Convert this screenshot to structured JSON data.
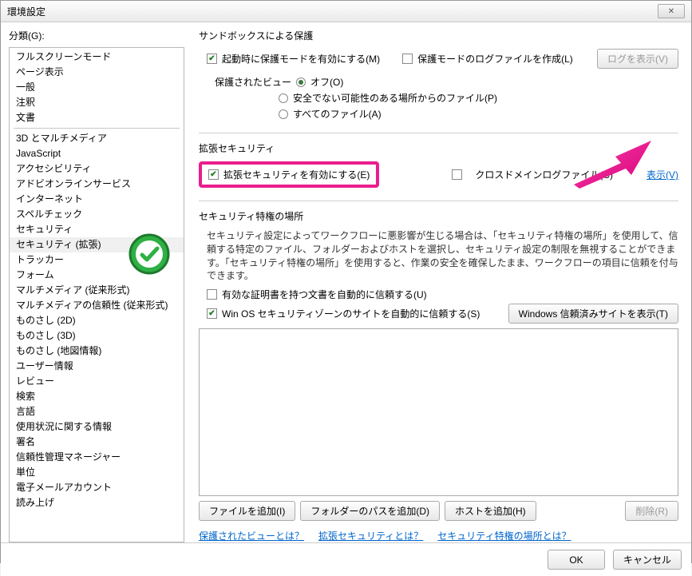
{
  "window": {
    "title": "環境設定",
    "close": "✕"
  },
  "sidebar": {
    "label": "分類(G):",
    "group1": [
      "フルスクリーンモード",
      "ページ表示",
      "一般",
      "注釈",
      "文書"
    ],
    "group2": [
      "3D とマルチメディア",
      "JavaScript",
      "アクセシビリティ",
      "アドビオンラインサービス",
      "インターネット",
      "スペルチェック",
      "セキュリティ",
      "セキュリティ (拡張)",
      "トラッカー",
      "フォーム",
      "マルチメディア (従来形式)",
      "マルチメディアの信頼性 (従来形式)",
      "ものさし (2D)",
      "ものさし (3D)",
      "ものさし (地図情報)",
      "ユーザー情報",
      "レビュー",
      "検索",
      "言語",
      "使用状況に関する情報",
      "署名",
      "信頼性管理マネージャー",
      "単位",
      "電子メールアカウント",
      "読み上げ"
    ],
    "selected": "セキュリティ (拡張)"
  },
  "sandbox": {
    "title": "サンドボックスによる保護",
    "enableProtected": "起動時に保護モードを有効にする(M)",
    "createLog": "保護モードのログファイルを作成(L)",
    "showLogBtn": "ログを表示(V)",
    "protectedViewLabel": "保護されたビュー",
    "radioOff": "オフ(O)",
    "radioUnsafe": "安全でない可能性のある場所からのファイル(P)",
    "radioAll": "すべてのファイル(A)"
  },
  "enhanced": {
    "title": "拡張セキュリティ",
    "enable": "拡張セキュリティを有効にする(E)",
    "crossDomain": "クロスドメインログファイル(C)",
    "showLink": "表示(V)"
  },
  "priv": {
    "title": "セキュリティ特権の場所",
    "desc": "セキュリティ設定によってワークフローに悪影響が生じる場合は、「セキュリティ特権の場所」を使用して、信頼する特定のファイル、フォルダーおよびホストを選択し、セキュリティ設定の制限を無視することができます。「セキュリティ特権の場所」を使用すると、作業の安全を確保したまま、ワークフローの項目に信頼を付与できます。",
    "autoTrustCert": "有効な証明書を持つ文書を自動的に信頼する(U)",
    "autoTrustWinOS": "Win OS セキュリティゾーンのサイトを自動的に信頼する(S)",
    "showWinSitesBtn": "Windows 信頼済みサイトを表示(T)",
    "addFile": "ファイルを追加(I)",
    "addFolder": "フォルダーのパスを追加(D)",
    "addHost": "ホストを追加(H)",
    "remove": "削除(R)"
  },
  "help": {
    "protectedView": "保護されたビューとは？",
    "enhancedSec": "拡張セキュリティとは？",
    "privLoc": "セキュリティ特権の場所とは？"
  },
  "footer": {
    "ok": "OK",
    "cancel": "キャンセル"
  }
}
